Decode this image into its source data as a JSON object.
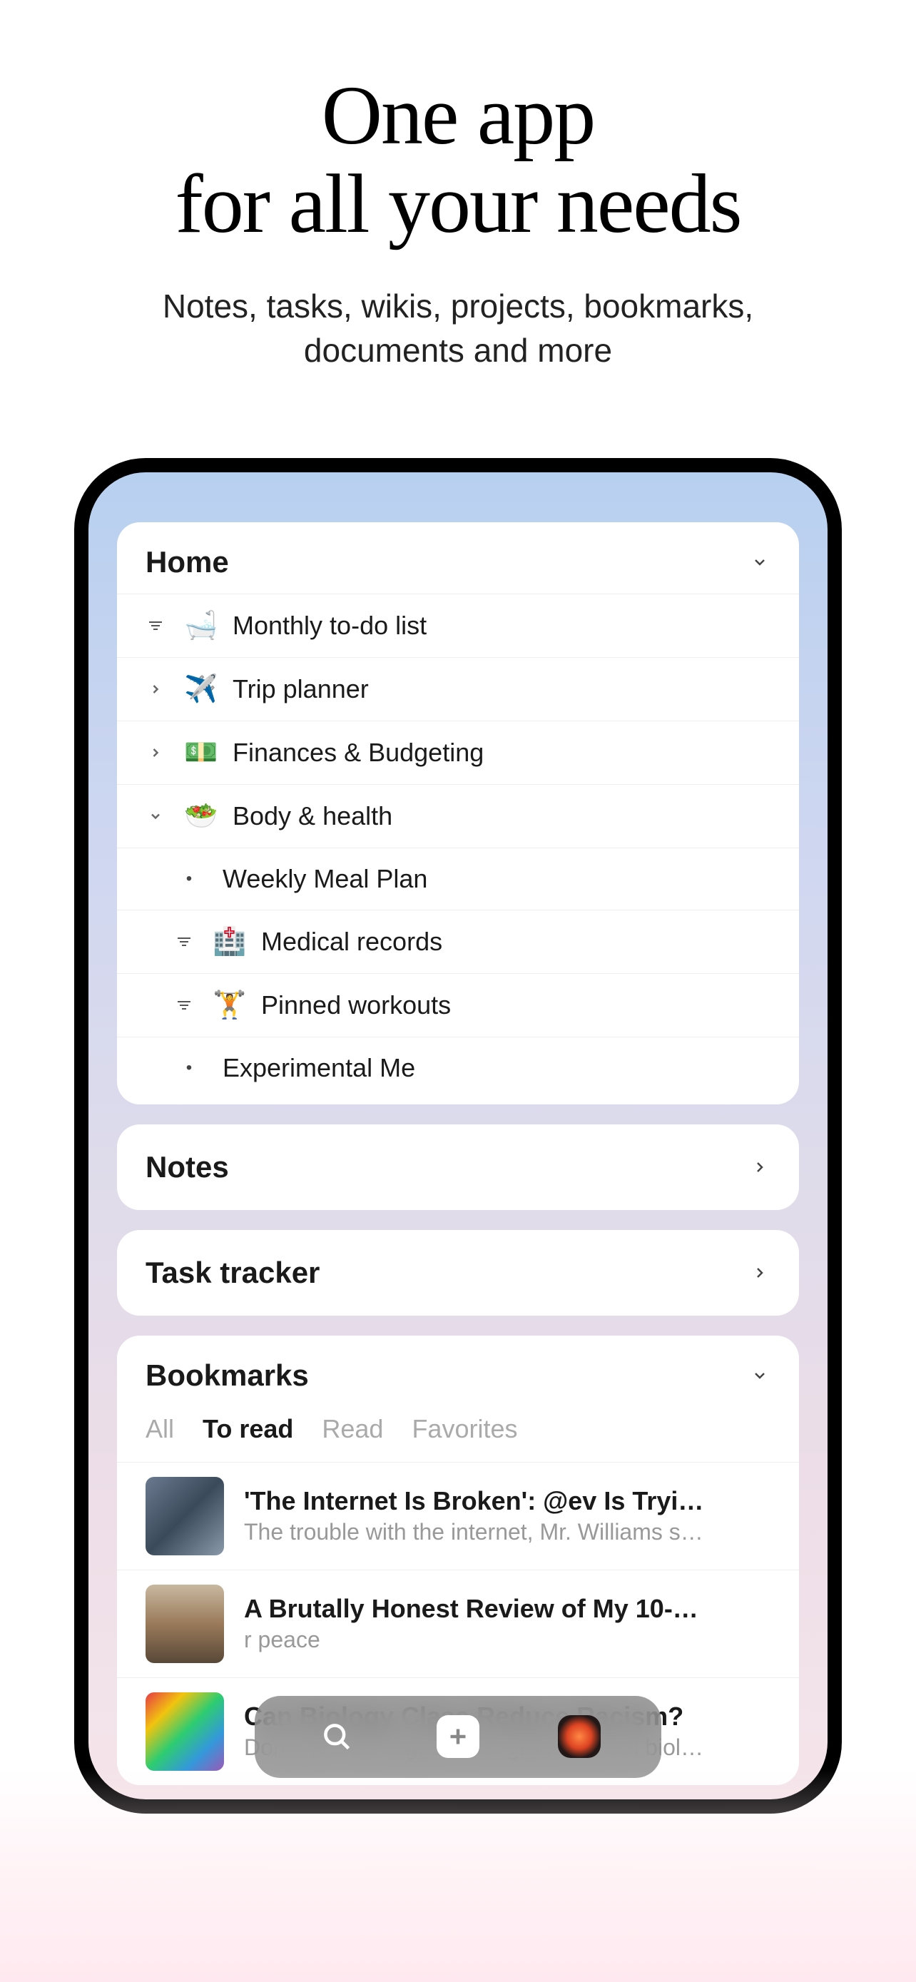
{
  "hero": {
    "title_line1": "One app",
    "title_line2": "for all your needs",
    "subtitle_line1": "Notes, tasks, wikis, projects, bookmarks,",
    "subtitle_line2": "documents and more"
  },
  "home": {
    "title": "Home",
    "items": [
      {
        "icon_type": "filter",
        "emoji": "🛁",
        "label": "Monthly to-do list"
      },
      {
        "icon_type": "arrow-right",
        "emoji": "✈️",
        "label": "Trip planner"
      },
      {
        "icon_type": "arrow-right",
        "emoji": "💵",
        "label": "Finances & Budgeting"
      },
      {
        "icon_type": "arrow-down",
        "emoji": "🥗",
        "label": "Body & health"
      }
    ],
    "subitems": [
      {
        "icon_type": "bullet",
        "label": "Weekly Meal Plan"
      },
      {
        "icon_type": "filter",
        "emoji": "🏥",
        "label": "Medical records"
      },
      {
        "icon_type": "filter",
        "emoji": "🏋️",
        "label": "Pinned workouts"
      },
      {
        "icon_type": "bullet",
        "label": "Experimental Me"
      }
    ]
  },
  "notes": {
    "title": "Notes"
  },
  "tasks": {
    "title": "Task tracker"
  },
  "bookmarks": {
    "title": "Bookmarks",
    "tabs": [
      "All",
      "To read",
      "Read",
      "Favorites"
    ],
    "active_tab": 1,
    "items": [
      {
        "title": "'The Internet Is Broken': @ev Is Tryi…",
        "desc": "The trouble with the internet, Mr. Williams s…"
      },
      {
        "title": "A Brutally Honest Review of My 10-…",
        "desc": "r peace"
      },
      {
        "title": "Can Biology Class Reduce Racism?",
        "desc": "Donovan has argued that grade-school biol…"
      }
    ]
  }
}
